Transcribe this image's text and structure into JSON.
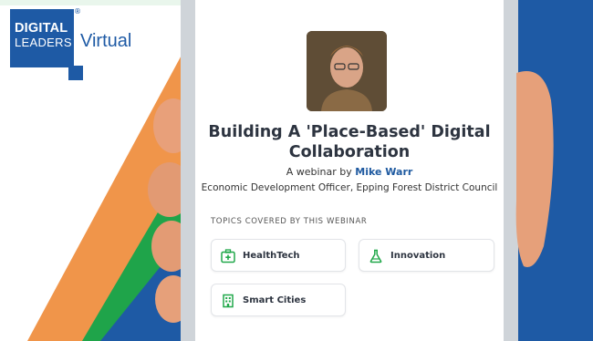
{
  "logo": {
    "line1": "DIGITAL",
    "line2": "LEADERS",
    "registered": "®",
    "virtual": "Virtual"
  },
  "webinar": {
    "title_line1": "Building A 'Place-Based' Digital",
    "title_line2": "Collaboration",
    "by_prefix": "A webinar by ",
    "speaker": "Mike Warr",
    "role": "Economic Development Officer, Epping Forest District Council",
    "topics_label": "TOPICS COVERED BY THIS WEBINAR",
    "topics": [
      {
        "label": "HealthTech",
        "icon": "medical-kit-icon"
      },
      {
        "label": "Innovation",
        "icon": "flask-icon"
      },
      {
        "label": "Smart Cities",
        "icon": "building-icon"
      }
    ]
  },
  "colors": {
    "brand_blue": "#1e5aa5",
    "orange": "#f0954a",
    "green": "#1fa44a",
    "icon_green": "#21a84a",
    "speaker_link": "#1f5aa0"
  }
}
